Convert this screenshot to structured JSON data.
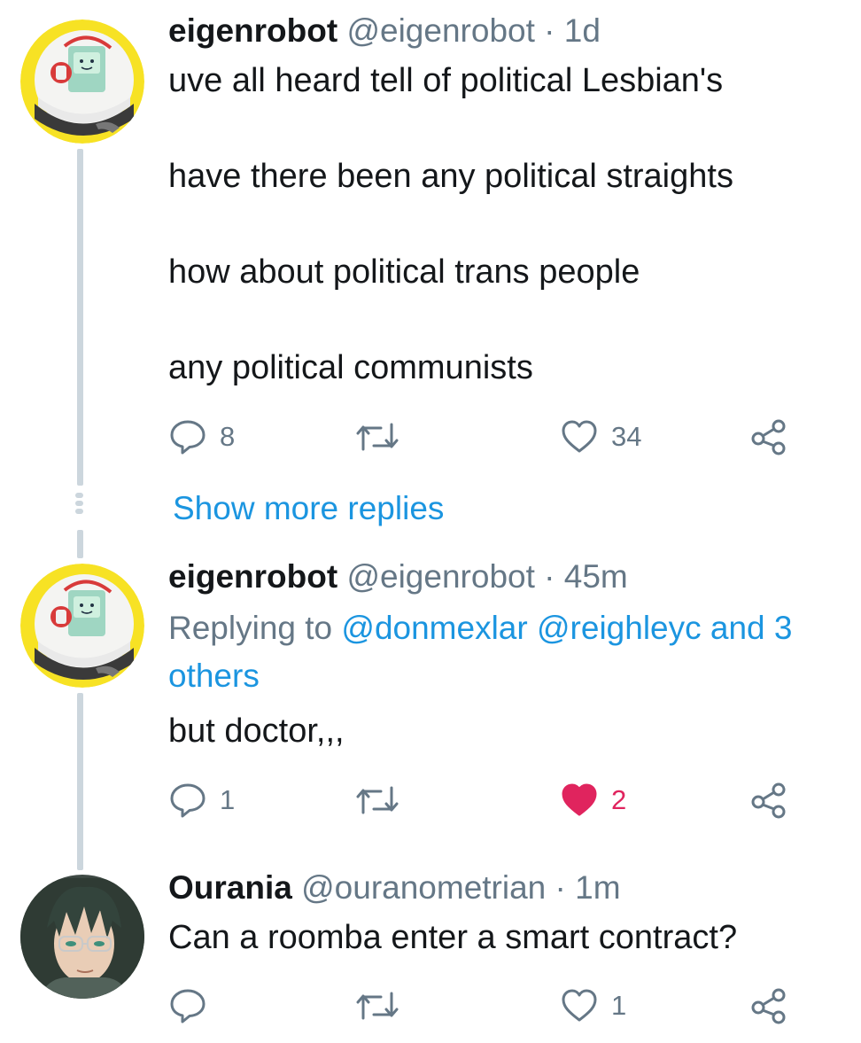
{
  "tweets": [
    {
      "name": "eigenrobot",
      "handle": "@eigenrobot",
      "time": "1d",
      "lines": [
        "uve all heard tell of political Lesbian's",
        "have there been any political straights",
        "how about political trans people",
        "any political communists"
      ],
      "replies": "8",
      "retweets": "",
      "likes": "34",
      "liked": false
    },
    {
      "name": "eigenrobot",
      "handle": "@eigenrobot",
      "time": "45m",
      "replying_prefix": "Replying to ",
      "replying_mentions": "@donmexlar @reighleyc and 3 others",
      "lines": [
        "but doctor,,,"
      ],
      "replies": "1",
      "retweets": "",
      "likes": "2",
      "liked": true
    },
    {
      "name": "Ourania",
      "handle": "@ouranometrian",
      "time": "1m",
      "lines": [
        "Can a roomba enter a smart contract?"
      ],
      "replies": "",
      "retweets": "",
      "likes": "1",
      "liked": false
    }
  ],
  "show_more_replies": "Show more replies",
  "separator": "·",
  "colors": {
    "link": "#1b95e0",
    "muted": "#657786",
    "like_active": "#e0245e",
    "thread_line": "#ccd6dd"
  }
}
